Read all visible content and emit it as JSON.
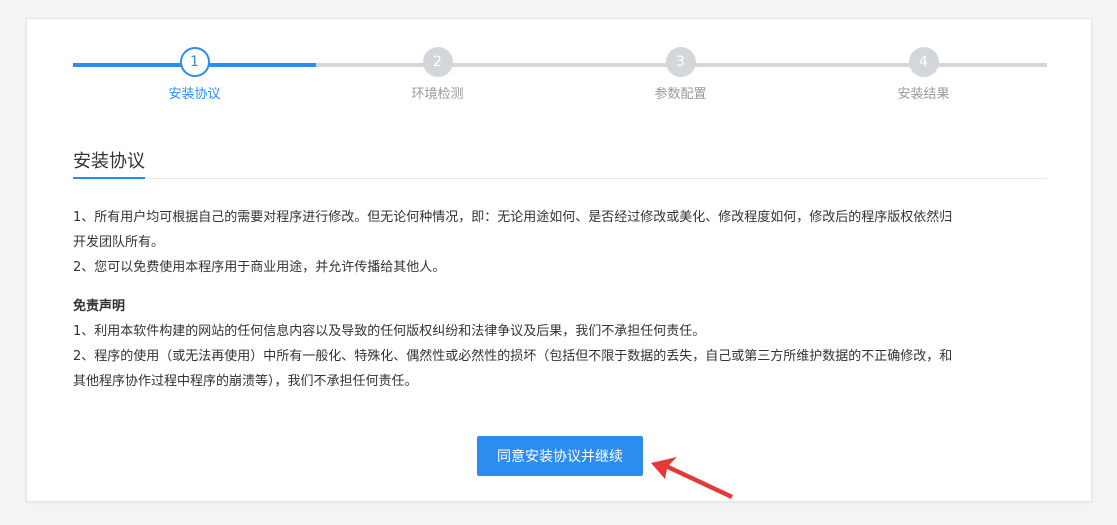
{
  "steps": [
    {
      "number": "1",
      "label": "安装协议",
      "state": "active"
    },
    {
      "number": "2",
      "label": "环境检测",
      "state": "todo"
    },
    {
      "number": "3",
      "label": "参数配置",
      "state": "todo"
    },
    {
      "number": "4",
      "label": "安装结果",
      "state": "todo"
    }
  ],
  "section": {
    "title": "安装协议"
  },
  "agreement": {
    "line1a": "1、所有用户均可根据自己的需要对程序进行修改。但无论何种情况，即：无论用途如何、是否经过修改或美化、修改程度如何，修改后的程序版权依然归",
    "line1b": "开发团队所有。",
    "line2": "2、您可以免费使用本程序用于商业用途，并允许传播给其他人。"
  },
  "disclaimer": {
    "heading": "免责声明",
    "line1": "1、利用本软件构建的网站的任何信息内容以及导致的任何版权纠纷和法律争议及后果，我们不承担任何责任。",
    "line2a": "2、程序的使用（或无法再使用）中所有一般化、特殊化、偶然性或必然性的损坏（包括但不限于数据的丢失，自己或第三方所维护数据的不正确修改，和",
    "line2b": "其他程序协作过程中程序的崩溃等），我们不承担任何责任。"
  },
  "actions": {
    "agree_label": "同意安装协议并继续"
  },
  "colors": {
    "primary": "#2d8cf0",
    "inactive": "#d3d7dc",
    "annotation": "#e53935"
  }
}
